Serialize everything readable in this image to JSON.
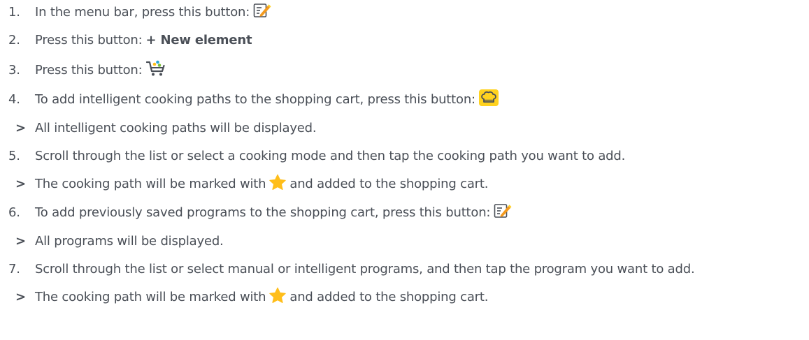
{
  "steps": [
    {
      "marker": "1.",
      "text": "In the menu bar, press this button: ",
      "icon": "notepad-pencil-icon"
    },
    {
      "marker": "2.",
      "text": "Press this button: ",
      "bold": "+ New element"
    },
    {
      "marker": "3.",
      "text": "Press this button: ",
      "icon": "shopping-cart-icon"
    },
    {
      "marker": "4.",
      "text": "To add intelligent cooking paths to the shopping cart, press this button: ",
      "icon": "chef-hat-icon"
    },
    {
      "marker": ">",
      "text": "All intelligent cooking paths will be displayed."
    },
    {
      "marker": "5.",
      "text": "Scroll through the list or select a cooking mode and then tap the cooking path you want to add."
    },
    {
      "marker": ">",
      "text_before": "The cooking path will be marked with",
      "icon": "star-icon",
      "text_after": "and added to the shopping cart."
    },
    {
      "marker": "6.",
      "text": "To add previously saved programs to the shopping cart, press this button: ",
      "icon": "notepad-pencil-icon"
    },
    {
      "marker": ">",
      "text": "All programs will be displayed."
    },
    {
      "marker": "7.",
      "text": "Scroll through the list or select manual or intelligent programs, and then tap the program you want to add."
    },
    {
      "marker": ">",
      "text_before": "The cooking path will be marked with",
      "icon": "star-icon",
      "text_after": "and added to the shopping cart."
    }
  ],
  "colors": {
    "text": "#4a4f57",
    "accent_yellow": "#ffd21f",
    "star_yellow": "#ffbe1a",
    "icon_gray": "#4a4f57",
    "icon_orange": "#f39a1e"
  }
}
